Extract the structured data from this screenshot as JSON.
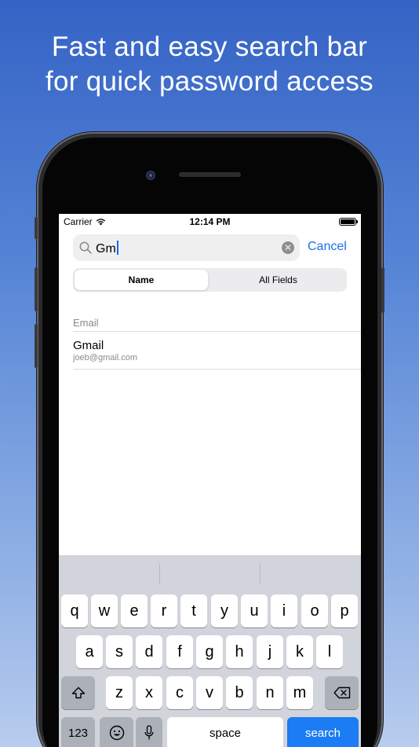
{
  "headline": {
    "line1": "Fast and easy search bar",
    "line2": "for quick password access"
  },
  "status_bar": {
    "carrier": "Carrier",
    "time": "12:14 PM"
  },
  "search": {
    "query": "Gm",
    "cancel_label": "Cancel",
    "icon": "search-icon",
    "clear_icon": "clear-icon"
  },
  "scope": {
    "options": [
      "Name",
      "All Fields"
    ],
    "selected": "Name"
  },
  "results": {
    "section_header": "Email",
    "items": [
      {
        "title": "Gmail",
        "subtitle": "joeb@gmail.com"
      }
    ]
  },
  "keyboard": {
    "row1": [
      "q",
      "w",
      "e",
      "r",
      "t",
      "y",
      "u",
      "i",
      "o",
      "p"
    ],
    "row2": [
      "a",
      "s",
      "d",
      "f",
      "g",
      "h",
      "j",
      "k",
      "l"
    ],
    "row3": [
      "z",
      "x",
      "c",
      "v",
      "b",
      "n",
      "m"
    ],
    "numbers_label": "123",
    "space_label": "space",
    "search_label": "search",
    "accent_color": "#1b7cf4"
  },
  "colors": {
    "link": "#1b6fe6",
    "background_top": "#3563c5",
    "background_bottom": "#b8ccee"
  }
}
